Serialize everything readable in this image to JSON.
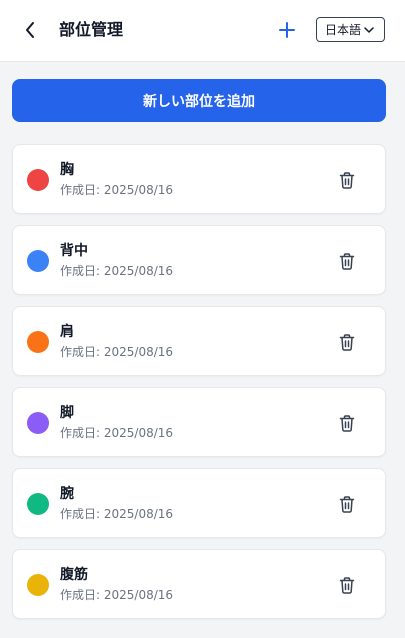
{
  "header": {
    "title": "部位管理",
    "language": "日本語",
    "icons": {
      "back": "chevron-left-icon",
      "add": "plus-icon",
      "dropdown": "chevron-down-icon"
    }
  },
  "main": {
    "add_button_label": "新しい部位を追加",
    "parts": [
      {
        "name": "胸",
        "created": "作成日: 2025/08/16",
        "color": "#ef4444"
      },
      {
        "name": "背中",
        "created": "作成日: 2025/08/16",
        "color": "#3b82f6"
      },
      {
        "name": "肩",
        "created": "作成日: 2025/08/16",
        "color": "#f97316"
      },
      {
        "name": "脚",
        "created": "作成日: 2025/08/16",
        "color": "#8b5cf6"
      },
      {
        "name": "腕",
        "created": "作成日: 2025/08/16",
        "color": "#10b981"
      },
      {
        "name": "腹筋",
        "created": "作成日: 2025/08/16",
        "color": "#eab308"
      }
    ]
  },
  "colors": {
    "accent": "#2563eb",
    "background": "#f3f4f6",
    "card": "#ffffff"
  }
}
